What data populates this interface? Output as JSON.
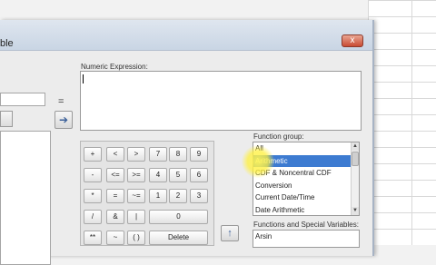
{
  "window": {
    "title": "ble",
    "close_glyph": "x"
  },
  "left_panel": {
    "equals": "="
  },
  "expression": {
    "label": "Numeric Expression:",
    "value": ""
  },
  "insert_arrow": "➔",
  "keypad": {
    "rows": [
      [
        "+",
        "<",
        ">",
        "7",
        "8",
        "9"
      ],
      [
        "-",
        "<=",
        ">=",
        "4",
        "5",
        "6"
      ],
      [
        "*",
        "=",
        "~=",
        "1",
        "2",
        "3"
      ],
      [
        "/",
        "&",
        "|",
        "0"
      ],
      [
        "**",
        "~",
        "( )",
        "Delete"
      ]
    ]
  },
  "up_arrow": "↑",
  "function_group": {
    "label": "Function group:",
    "items": [
      "All",
      "Arithmetic",
      "CDF & Noncentral CDF",
      "Conversion",
      "Current Date/Time",
      "Date Arithmetic"
    ],
    "selected": "Arithmetic"
  },
  "functions_vars": {
    "label": "Functions and Special Variables:",
    "items": [
      "Arsin"
    ]
  },
  "colors": {
    "selection": "#3d7bd1",
    "highlight": "#fff23c",
    "close": "#c94a32"
  }
}
